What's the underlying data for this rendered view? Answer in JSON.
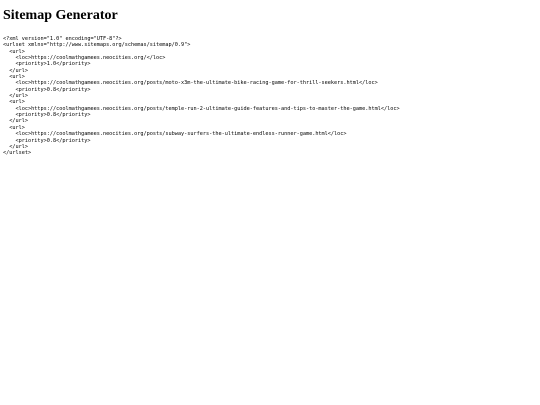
{
  "page": {
    "title": "Sitemap Generator"
  },
  "sitemap": {
    "xml": "<?xml version=\"1.0\" encoding=\"UTF-8\"?>\n<urlset xmlns=\"http://www.sitemaps.org/schemas/sitemap/0.9\">\n  <url>\n    <loc>https://coolmathgamees.neocities.org/</loc>\n    <priority>1.0</priority>\n  </url>\n  <url>\n    <loc>https://coolmathgamees.neocities.org/posts/moto-x3m-the-ultimate-bike-racing-game-for-thrill-seekers.html</loc>\n    <priority>0.8</priority>\n  </url>\n  <url>\n    <loc>https://coolmathgamees.neocities.org/posts/temple-run-2-ultimate-guide-features-and-tips-to-master-the-game.html</loc>\n    <priority>0.8</priority>\n  </url>\n  <url>\n    <loc>https://coolmathgamees.neocities.org/posts/subway-surfers-the-ultimate-endless-runner-game.html</loc>\n    <priority>0.8</priority>\n  </url>\n</urlset>"
  }
}
